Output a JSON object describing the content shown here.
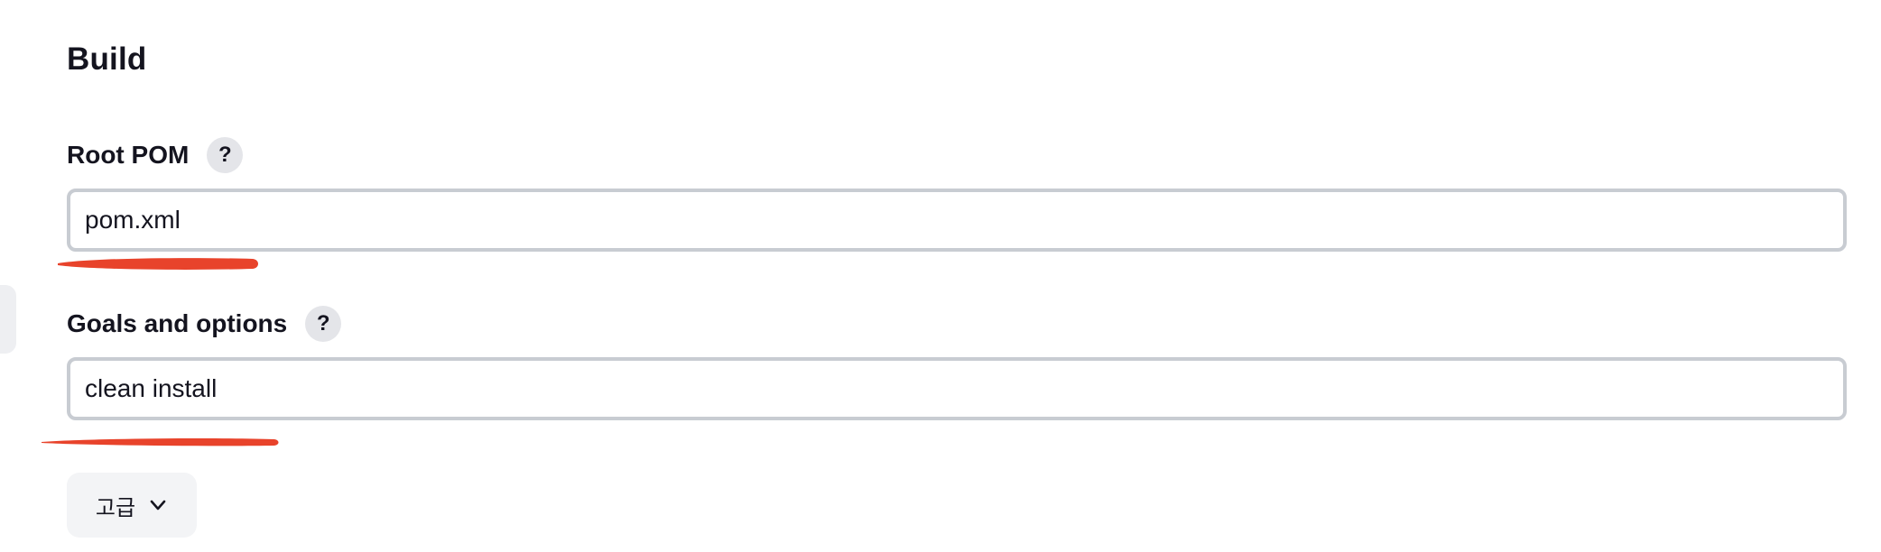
{
  "section": {
    "title": "Build"
  },
  "root_pom": {
    "label": "Root POM",
    "help": "?",
    "value": "pom.xml"
  },
  "goals": {
    "label": "Goals and options",
    "help": "?",
    "value": "clean install"
  },
  "advanced": {
    "label": "고급",
    "icon": "chevron-down-icon"
  },
  "colors": {
    "annotation": "#e8432b",
    "input_border": "#c8ccd2",
    "help_bg": "#e4e5e9",
    "button_bg": "#f3f4f6"
  }
}
